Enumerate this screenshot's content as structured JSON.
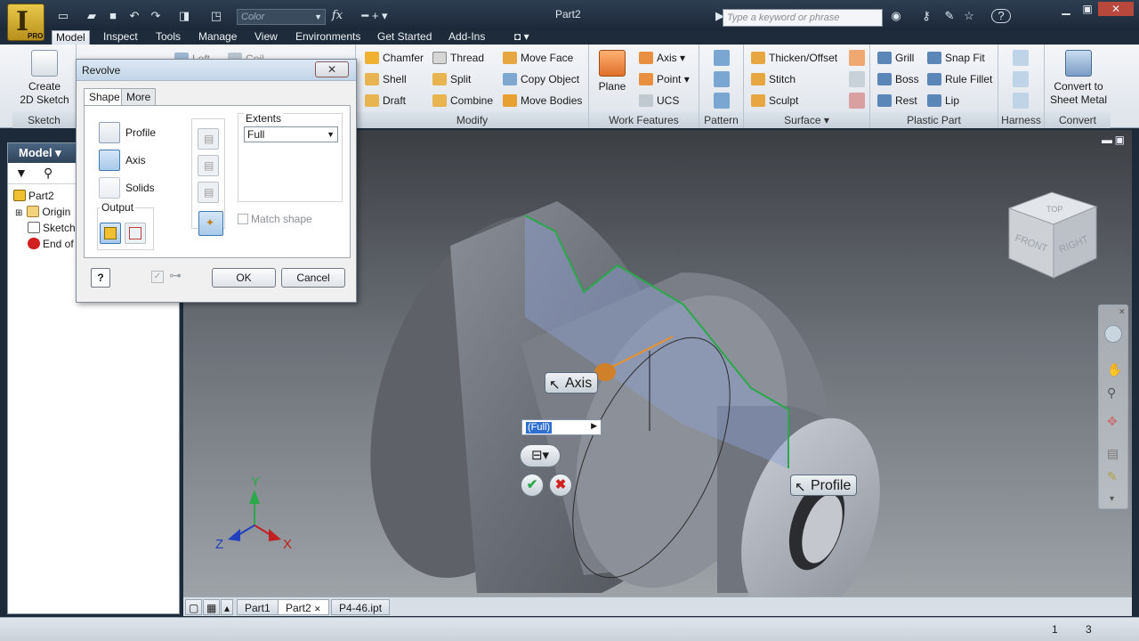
{
  "app": {
    "logo_letter": "I",
    "edition": "PRO",
    "document_title": "Part2",
    "search_placeholder": "Type a keyword or phrase",
    "color_placeholder": "Color",
    "fx_label": "fx"
  },
  "tabs": [
    "Model",
    "Inspect",
    "Tools",
    "Manage",
    "View",
    "Environments",
    "Get Started",
    "Add-Ins"
  ],
  "active_tab": "Model",
  "ribbon": {
    "sketch": {
      "create_label_1": "Create",
      "create_label_2": "2D Sketch",
      "panel": "Sketch"
    },
    "modify": {
      "items": [
        "Chamfer",
        "Thread",
        "Move Face",
        "Shell",
        "Split",
        "Copy Object",
        "Draft",
        "Combine",
        "Move Bodies"
      ],
      "panel": "Modify"
    },
    "work_features": {
      "plane": "Plane",
      "items": [
        "Axis",
        "Point",
        "UCS"
      ],
      "panel": "Work Features"
    },
    "pattern": {
      "panel": "Pattern"
    },
    "surface": {
      "items": [
        "Thicken/Offset",
        "Stitch",
        "Sculpt"
      ],
      "panel": "Surface"
    },
    "plastic": {
      "items": [
        "Grill",
        "Snap Fit",
        "Boss",
        "Rule Fillet",
        "Rest",
        "Lip"
      ],
      "panel": "Plastic Part"
    },
    "harness": {
      "panel": "Harness"
    },
    "convert": {
      "label_1": "Convert to",
      "label_2": "Sheet Metal",
      "panel": "Convert"
    },
    "hidden_items": [
      "Loft",
      "Coil"
    ]
  },
  "browser": {
    "title": "Model",
    "items": [
      "Part2",
      "Origin",
      "Sketch",
      "End of Part"
    ]
  },
  "revolve": {
    "title": "Revolve",
    "close": "✕",
    "tabs": [
      "Shape",
      "More"
    ],
    "profile": "Profile",
    "axis": "Axis",
    "solids": "Solids",
    "output": "Output",
    "extents_label": "Extents",
    "extents_value": "Full",
    "match_shape": "Match shape",
    "help": "?",
    "ok": "OK",
    "cancel": "Cancel"
  },
  "viewport": {
    "axis_callout": "Axis",
    "profile_callout": "Profile",
    "mini_combo": "(Full)",
    "triad": {
      "x": "X",
      "y": "Y",
      "z": "Z"
    },
    "viewcube": {
      "top": "TOP",
      "front": "FRONT",
      "right": "RIGHT"
    }
  },
  "doc_tabs": [
    "Part1",
    "Part2",
    "P4-46.ipt"
  ],
  "active_doc": "Part2",
  "status": {
    "left_count": "1",
    "right_count": "3"
  },
  "colors": {
    "accent": "#2f6fd0",
    "profile_line": "#2aa84a",
    "axis_line": "#e8932a"
  }
}
